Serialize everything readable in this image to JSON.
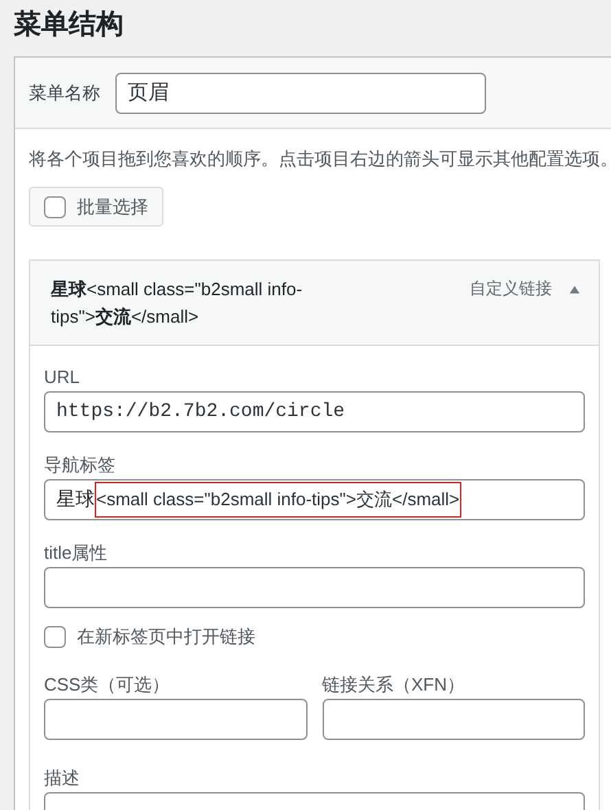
{
  "page_title": "菜单结构",
  "menu_name": {
    "label": "菜单名称",
    "value": "页眉"
  },
  "instructions": "将各个项目拖到您喜欢的顺序。点击项目右边的箭头可显示其他配置选项。",
  "bulk_select": {
    "label": "批量选择",
    "checked": false
  },
  "menu_item": {
    "title": "**星球**<small class=\"b2small info-tips\">**交流**</small>",
    "type": "自定义链接",
    "expanded": true,
    "url": {
      "label": "URL",
      "value": "https://b2.7b2.com/circle"
    },
    "nav_label": {
      "label": "导航标签",
      "value_parts": [
        {
          "text": "星球",
          "highlighted": false
        },
        {
          "text": "<small class=\"b2small info-tips\">交流</small>",
          "highlighted": true
        }
      ]
    },
    "title_attr": {
      "label": "title属性"
    },
    "new_tab": {
      "label": "在新标签页中打开链接",
      "checked": false
    },
    "css_classes": {
      "label": "CSS类（可选）"
    },
    "xfn": {
      "label": "链接关系（XFN）"
    },
    "description": {
      "label": "描述"
    }
  }
}
